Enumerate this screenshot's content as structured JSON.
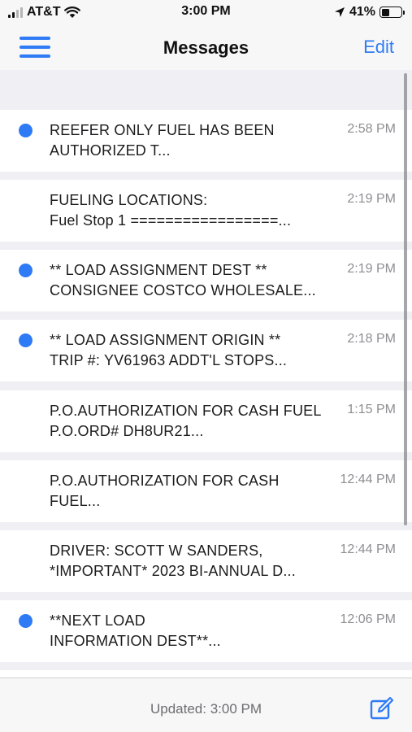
{
  "status_bar": {
    "carrier": "AT&T",
    "time": "3:00 PM",
    "battery": "41%",
    "battery_level": 0.41,
    "icons": [
      "signal-icon",
      "wifi-icon",
      "location-arrow-icon",
      "battery-icon"
    ]
  },
  "nav": {
    "title": "Messages",
    "edit_label": "Edit",
    "menu_icon": "hamburger-menu-icon"
  },
  "messages": [
    {
      "unread": true,
      "line1": "REEFER ONLY FUEL HAS BEEN",
      "line2": "AUTHORIZED T...",
      "time": "2:58 PM"
    },
    {
      "unread": false,
      "line1": "FUELING LOCATIONS:",
      "line2": "Fuel Stop 1 =================...",
      "time": "2:19 PM"
    },
    {
      "unread": true,
      "line1": "** LOAD ASSIGNMENT DEST  **",
      "line2": "CONSIGNEE COSTCO WHOLESALE...",
      "time": "2:19 PM"
    },
    {
      "unread": true,
      "line1": "** LOAD ASSIGNMENT ORIGIN **",
      "line2": "TRIP #: YV61963  ADDT'L STOPS...",
      "time": "2:18 PM"
    },
    {
      "unread": false,
      "line1": "P.O.AUTHORIZATION FOR CASH FUEL",
      "line2": "P.O.ORD# DH8UR21...",
      "time": "1:15 PM"
    },
    {
      "unread": false,
      "line1": "P.O.AUTHORIZATION FOR CASH",
      "line2": "FUEL...",
      "time": "12:44 PM"
    },
    {
      "unread": false,
      "line1": "DRIVER: SCOTT W SANDERS,",
      "line2": "*IMPORTANT* 2023 BI-ANNUAL D...",
      "time": "12:44 PM"
    },
    {
      "unread": true,
      "line1": "**NEXT LOAD",
      "line2": "INFORMATION DEST**...",
      "time": "12:06 PM"
    }
  ],
  "toolbar": {
    "updated_text": "Updated: 3:00 PM",
    "compose_icon": "compose-icon"
  },
  "colors": {
    "accent": "#2f7bf5",
    "background": "#efeff4",
    "secondary_text": "#8e8e93"
  }
}
